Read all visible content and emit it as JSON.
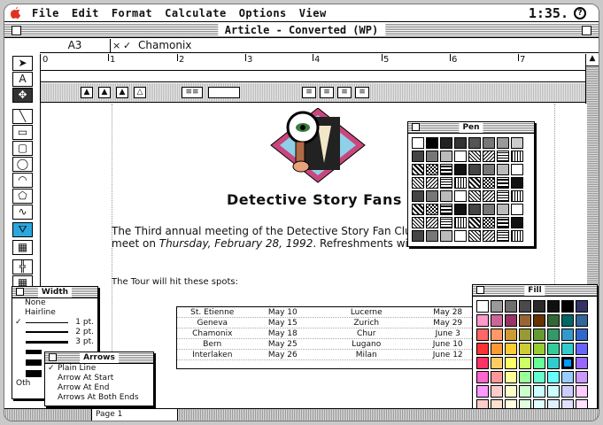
{
  "menubar": {
    "items": [
      "File",
      "Edit",
      "Format",
      "Calculate",
      "Options",
      "View"
    ],
    "clock": "1:35.",
    "help_icon": "?"
  },
  "window": {
    "title": "Article - Converted (WP)"
  },
  "entry_bar": {
    "cell_ref": "A3",
    "cancel": "×",
    "accept": "✓",
    "value": "Chamonix"
  },
  "ruler": {
    "numbers": [
      "0",
      "1",
      "2",
      "3",
      "4",
      "5",
      "6",
      "7"
    ]
  },
  "document": {
    "heading": "Detective Story Fans",
    "para_line1": "The Third annual meeting of the Detective Story Fan Club",
    "para_line2_a": "meet on ",
    "para_line2_b": "Thursday, February 28, 1992",
    "para_line2_c": ". Refreshments will be",
    "tour_line": "The Tour will hit these spots:",
    "table": [
      [
        "St. Etienne",
        "May 10",
        "Lucerne",
        "May 28"
      ],
      [
        "Geneva",
        "May 15",
        "Zurich",
        "May 29"
      ],
      [
        "Chamonix",
        "May 18",
        "Chur",
        "June 3"
      ],
      [
        "Bern",
        "May 25",
        "Lugano",
        "June 10"
      ],
      [
        "Interlaken",
        "May 26",
        "Milan",
        "June 12"
      ]
    ]
  },
  "pen_palette": {
    "title": "Pen"
  },
  "fill_palette": {
    "title": "Fill",
    "colors": [
      "#ffffff",
      "#9a9a9a",
      "#6e6e6e",
      "#4a4a4a",
      "#2a2a2a",
      "#101010",
      "#000000",
      "#333366",
      "#ff99cc",
      "#cc6699",
      "#993366",
      "#996633",
      "#663300",
      "#336633",
      "#006666",
      "#336699",
      "#ff6666",
      "#ff9966",
      "#cc9933",
      "#999933",
      "#669933",
      "#339966",
      "#3399cc",
      "#3366cc",
      "#ff3333",
      "#ff9933",
      "#ffcc33",
      "#cccc33",
      "#99cc33",
      "#33cc99",
      "#33cccc",
      "#6666ff",
      "#ff3366",
      "#ffcc66",
      "#ffff66",
      "#ccff66",
      "#66ff99",
      "#33cccc",
      "#0099ff",
      "#9966ff",
      "#ff66cc",
      "#ff9999",
      "#ffff99",
      "#99ff99",
      "#66ffcc",
      "#66ffff",
      "#99ccff",
      "#cc99ff",
      "#ff99ff",
      "#ffcccc",
      "#ffffcc",
      "#ccffcc",
      "#ccffff",
      "#ccffff",
      "#ccccff",
      "#ffccff",
      "#ffcccc",
      "#ffe0cc",
      "#ffffe0",
      "#e0ffe0",
      "#e0ffff",
      "#e0f0ff",
      "#e0e0ff",
      "#ffe0ff"
    ],
    "selected_index": 38
  },
  "width_menu": {
    "title": "Width",
    "items": [
      "None",
      "Hairline",
      "1 pt.",
      "2 pt.",
      "3 pt."
    ],
    "other": "Oth",
    "checked_index": 2
  },
  "arrows_menu": {
    "title": "Arrows",
    "items": [
      "Plain Line",
      "Arrow At Start",
      "Arrow At End",
      "Arrows At Both Ends"
    ],
    "checked_index": 0
  },
  "bottom_bar": {
    "page_label": "Page 1"
  }
}
